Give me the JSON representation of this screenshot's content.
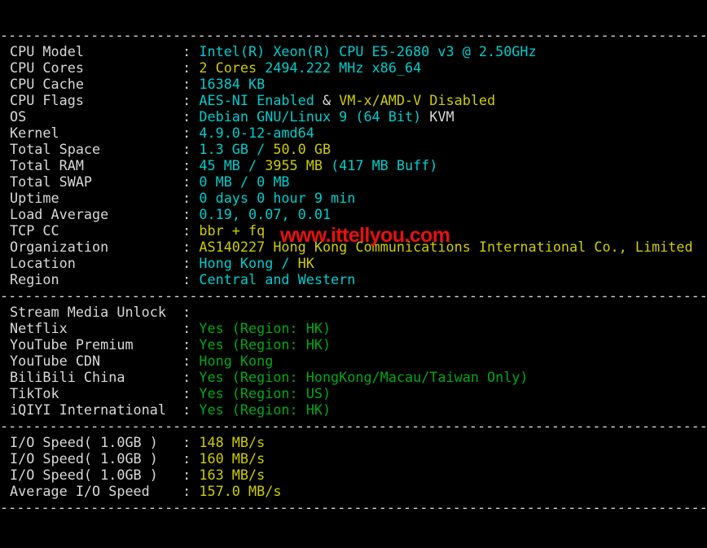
{
  "terminal": {
    "title": "VPS Benchmark Output",
    "separator_char": "-",
    "separator_line": "--------------------------------------------------------------------------------------",
    "colors": {
      "background": "#000000",
      "default_text": "#d8d8d8",
      "cyan": "#00cdcd",
      "yellow": "#cdcd00",
      "green": "#00a818",
      "watermark_red": "#e8110f"
    },
    "watermark": "www.ittellyou.com",
    "sections": [
      {
        "name": "system-info",
        "rows": [
          {
            "label": "CPU Model",
            "segments": [
              {
                "text": "Intel(R) Xeon(R) CPU E5-2680 v3 @ 2.50GHz",
                "color": "cyan"
              }
            ]
          },
          {
            "label": "CPU Cores",
            "segments": [
              {
                "text": "2 Cores ",
                "color": "yellow"
              },
              {
                "text": "2494.222 MHz x86_64",
                "color": "cyan"
              }
            ]
          },
          {
            "label": "CPU Cache",
            "segments": [
              {
                "text": "16384 KB",
                "color": "cyan"
              }
            ]
          },
          {
            "label": "CPU Flags",
            "segments": [
              {
                "text": "AES-NI Enabled ",
                "color": "cyan"
              },
              {
                "text": "& ",
                "color": "white"
              },
              {
                "text": "VM-x/AMD-V Disabled",
                "color": "yellow"
              }
            ]
          },
          {
            "label": "OS",
            "segments": [
              {
                "text": "Debian GNU/Linux 9 (64 Bit) ",
                "color": "cyan"
              },
              {
                "text": "KVM",
                "color": "white"
              }
            ]
          },
          {
            "label": "Kernel",
            "segments": [
              {
                "text": "4.9.0-12-amd64",
                "color": "cyan"
              }
            ]
          },
          {
            "label": "Total Space",
            "segments": [
              {
                "text": "1.3 GB ",
                "color": "cyan"
              },
              {
                "text": "/ ",
                "color": "cyan"
              },
              {
                "text": "50.0 GB",
                "color": "yellow"
              }
            ]
          },
          {
            "label": "Total RAM",
            "segments": [
              {
                "text": "45 MB ",
                "color": "cyan"
              },
              {
                "text": "/ ",
                "color": "cyan"
              },
              {
                "text": "3955 MB ",
                "color": "yellow"
              },
              {
                "text": "(417 MB Buff)",
                "color": "cyan"
              }
            ]
          },
          {
            "label": "Total SWAP",
            "segments": [
              {
                "text": "0 MB / 0 MB",
                "color": "cyan"
              }
            ]
          },
          {
            "label": "Uptime",
            "segments": [
              {
                "text": "0 days 0 hour 9 min",
                "color": "cyan"
              }
            ]
          },
          {
            "label": "Load Average",
            "segments": [
              {
                "text": "0.19, 0.07, 0.01",
                "color": "cyan"
              }
            ]
          },
          {
            "label": "TCP CC",
            "segments": [
              {
                "text": "bbr + fq",
                "color": "yellow"
              }
            ]
          },
          {
            "label": "Organization",
            "segments": [
              {
                "text": "AS140227 Hong Kong Communications International Co., Limited",
                "color": "yellow"
              }
            ]
          },
          {
            "label": "Location",
            "segments": [
              {
                "text": "Hong Kong / ",
                "color": "cyan"
              },
              {
                "text": "HK",
                "color": "yellow"
              }
            ]
          },
          {
            "label": "Region",
            "segments": [
              {
                "text": "Central and Western",
                "color": "cyan"
              }
            ]
          }
        ]
      },
      {
        "name": "stream-media-unlock",
        "rows": [
          {
            "label": "Stream Media Unlock",
            "segments": []
          },
          {
            "label": "Netflix",
            "segments": [
              {
                "text": "Yes (Region: HK)",
                "color": "green"
              }
            ]
          },
          {
            "label": "YouTube Premium",
            "segments": [
              {
                "text": "Yes (Region: HK)",
                "color": "green"
              }
            ]
          },
          {
            "label": "YouTube CDN",
            "segments": [
              {
                "text": "Hong Kong",
                "color": "green"
              }
            ]
          },
          {
            "label": "BiliBili China",
            "segments": [
              {
                "text": "Yes (Region: HongKong/Macau/Taiwan Only)",
                "color": "green"
              }
            ]
          },
          {
            "label": "TikTok",
            "segments": [
              {
                "text": "Yes (Region: US)",
                "color": "green"
              }
            ]
          },
          {
            "label": "iQIYI International",
            "segments": [
              {
                "text": "Yes (Region: HK)",
                "color": "green"
              }
            ]
          }
        ]
      },
      {
        "name": "io-speed",
        "rows": [
          {
            "label": "I/O Speed( 1.0GB )",
            "segments": [
              {
                "text": "148 MB/s",
                "color": "yellow"
              }
            ]
          },
          {
            "label": "I/O Speed( 1.0GB )",
            "segments": [
              {
                "text": "160 MB/s",
                "color": "yellow"
              }
            ]
          },
          {
            "label": "I/O Speed( 1.0GB )",
            "segments": [
              {
                "text": "163 MB/s",
                "color": "yellow"
              }
            ]
          },
          {
            "label": "Average I/O Speed",
            "segments": [
              {
                "text": "157.0 MB/s",
                "color": "yellow"
              }
            ]
          }
        ]
      }
    ]
  }
}
